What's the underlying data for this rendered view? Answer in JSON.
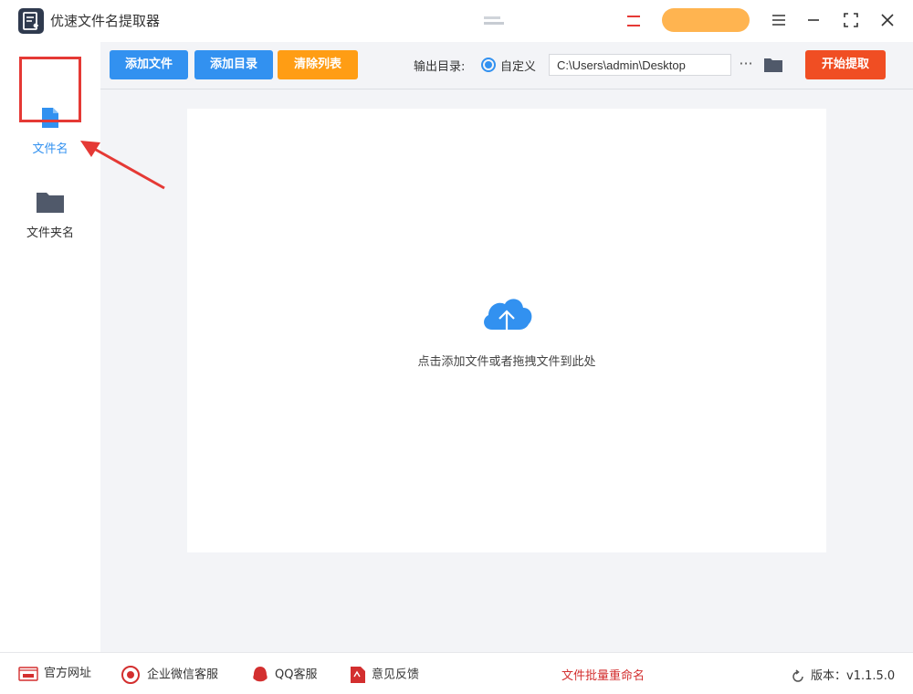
{
  "app": {
    "title": "优速文件名提取器"
  },
  "titlebar": {
    "vip_color": "#ffb450"
  },
  "sidebar": {
    "items": [
      {
        "label": "文件名",
        "icon": "file-icon",
        "active": true
      },
      {
        "label": "文件夹名",
        "icon": "folder-icon",
        "active": false
      }
    ]
  },
  "toolbar": {
    "add_file": "添加文件",
    "add_dir": "添加目录",
    "clear_list": "清除列表",
    "output_label": "输出目录:",
    "custom_label": "自定义",
    "output_path": "C:\\Users\\admin\\Desktop",
    "more": "···",
    "start": "开始提取"
  },
  "dropzone": {
    "hint": "点击添加文件或者拖拽文件到此处"
  },
  "footer": {
    "website": "官方网址",
    "wechat": "企业微信客服",
    "qq": "QQ客服",
    "feedback": "意见反馈",
    "center_link": "文件批量重命名",
    "version": "版本：v1.1.5.0"
  },
  "colors": {
    "accent": "#3291f0",
    "orange": "#ff9d14",
    "red": "#f04e23",
    "highlight": "#e53935"
  }
}
